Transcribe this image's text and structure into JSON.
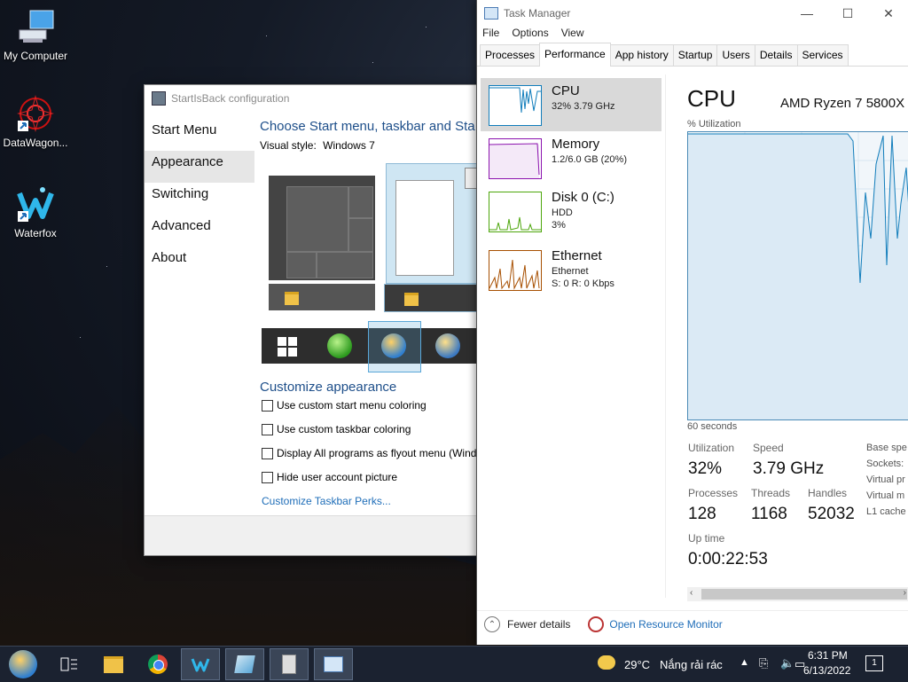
{
  "desktop": {
    "icons": [
      {
        "label": "My Computer",
        "icon": "computer-icon"
      },
      {
        "label": "DataWagon...",
        "icon": "datawagon-icon"
      },
      {
        "label": "Waterfox",
        "icon": "waterfox-icon"
      }
    ]
  },
  "startisback": {
    "title": "StartIsBack configuration",
    "nav": [
      "Start Menu",
      "Appearance",
      "Switching",
      "Advanced",
      "About"
    ],
    "active_nav": "Appearance",
    "heading": "Choose Start menu, taskbar and Sta",
    "visual_style_label": "Visual style:",
    "visual_style_value": "Windows 7",
    "customize_heading": "Customize appearance",
    "checkboxes": [
      {
        "label": "Use custom start menu coloring",
        "checked": false
      },
      {
        "label": "Use custom taskbar coloring",
        "checked": false
      },
      {
        "label": "Display All programs as flyout menu (Wind",
        "checked": false
      },
      {
        "label": "Hide user account picture",
        "checked": false
      }
    ],
    "link": "Customize Taskbar Perks..."
  },
  "taskmanager": {
    "title": "Task Manager",
    "menu": [
      "File",
      "Options",
      "View"
    ],
    "tabs": [
      "Processes",
      "Performance",
      "App history",
      "Startup",
      "Users",
      "Details",
      "Services"
    ],
    "active_tab": "Performance",
    "resources": [
      {
        "name": "CPU",
        "line1": "32%  3.79 GHz",
        "line2": "",
        "color": "#117dbb"
      },
      {
        "name": "Memory",
        "line1": "1.2/6.0 GB (20%)",
        "line2": "",
        "color": "#8b12ae"
      },
      {
        "name": "Disk 0 (C:)",
        "line1": "HDD",
        "line2": "3%",
        "color": "#4da60c"
      },
      {
        "name": "Ethernet",
        "line1": "Ethernet",
        "line2": "S: 0  R: 0 Kbps",
        "color": "#a74f01"
      }
    ],
    "detail": {
      "title": "CPU",
      "model": "AMD Ryzen 7 5800X",
      "util_label": "% Utilization",
      "seconds_label": "60 seconds",
      "utilization_label": "Utilization",
      "utilization_value": "32%",
      "speed_label": "Speed",
      "speed_value": "3.79 GHz",
      "processes_label": "Processes",
      "processes_value": "128",
      "threads_label": "Threads",
      "threads_value": "1168",
      "handles_label": "Handles",
      "handles_value": "52032",
      "uptime_label": "Up time",
      "uptime_value": "0:00:22:53",
      "side_labels": [
        "Base spe",
        "Sockets:",
        "Virtual pr",
        "Virtual m",
        "L1 cache"
      ]
    },
    "footer": {
      "fewer": "Fewer details",
      "resource_monitor": "Open Resource Monitor"
    }
  },
  "taskbar": {
    "weather": "29°C",
    "weather_desc": "Nắng rải rác",
    "time": "6:31 PM",
    "date": "6/13/2022",
    "notification_count": "1"
  }
}
